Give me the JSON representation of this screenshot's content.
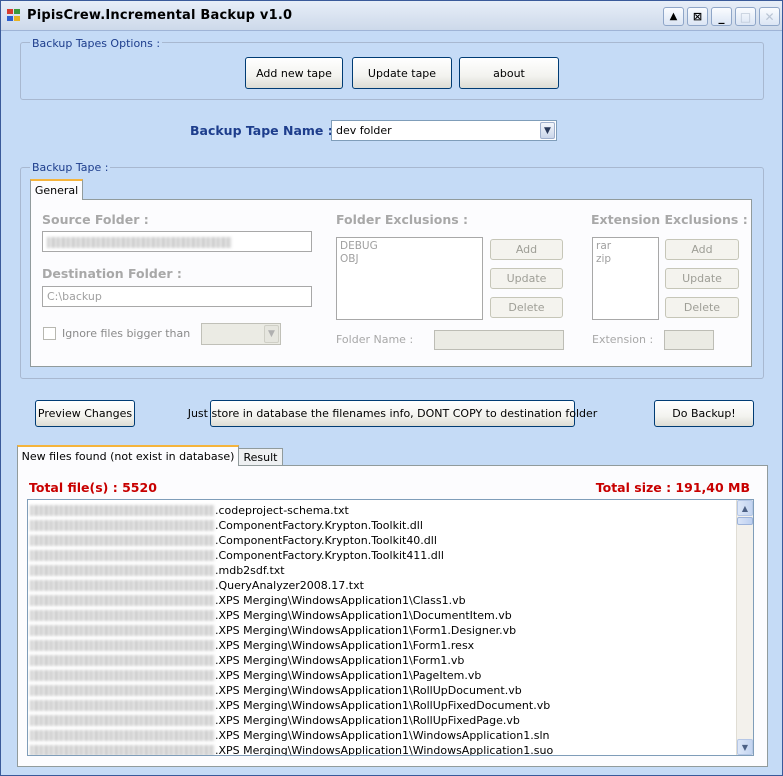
{
  "window": {
    "title": "PipisCrew.Incremental Backup v1.0",
    "controls": {
      "up": "▲",
      "pin": "⊠",
      "minimize": "_",
      "maximize": "□",
      "close": "✕"
    }
  },
  "tape_options": {
    "title": "Backup Tapes Options :",
    "buttons": {
      "add_new": "Add new tape",
      "update": "Update tape",
      "about": "about"
    }
  },
  "tape_name": {
    "label": "Backup Tape Name :",
    "selected": "dev folder"
  },
  "backup_tape": {
    "title": "Backup Tape :",
    "tab_general": "General",
    "source_label": "Source Folder :",
    "destination_label": "Destination Folder :",
    "destination_value": "C:\\backup",
    "ignore_label": "Ignore files bigger than",
    "folder_exclusions": {
      "title": "Folder Exclusions :",
      "items": [
        "DEBUG",
        "OBJ"
      ],
      "add": "Add",
      "update": "Update",
      "delete": "Delete",
      "name_label": "Folder Name :"
    },
    "extension_exclusions": {
      "title": "Extension Exclusions :",
      "items": [
        "rar",
        "zip"
      ],
      "add": "Add",
      "update": "Update",
      "delete": "Delete",
      "name_label": "Extension :"
    }
  },
  "actions": {
    "preview": "Preview Changes",
    "store_only": "Just store in database the filenames info, DONT COPY to destination folder",
    "do_backup": "Do Backup!"
  },
  "results": {
    "tab_new": "New files found (not exist in database)",
    "tab_result": "Result",
    "total_files": "Total file(s) : 5520",
    "total_size": "Total size : 191,40 MB",
    "files": [
      ".codeproject-schema.txt",
      ".ComponentFactory.Krypton.Toolkit.dll",
      ".ComponentFactory.Krypton.Toolkit40.dll",
      ".ComponentFactory.Krypton.Toolkit411.dll",
      ".mdb2sdf.txt",
      ".QueryAnalyzer2008.17.txt",
      ".XPS Merging\\WindowsApplication1\\Class1.vb",
      ".XPS Merging\\WindowsApplication1\\DocumentItem.vb",
      ".XPS Merging\\WindowsApplication1\\Form1.Designer.vb",
      ".XPS Merging\\WindowsApplication1\\Form1.resx",
      ".XPS Merging\\WindowsApplication1\\Form1.vb",
      ".XPS Merging\\WindowsApplication1\\PageItem.vb",
      ".XPS Merging\\WindowsApplication1\\RollUpDocument.vb",
      ".XPS Merging\\WindowsApplication1\\RollUpFixedDocument.vb",
      ".XPS Merging\\WindowsApplication1\\RollUpFixedPage.vb",
      ".XPS Merging\\WindowsApplication1\\WindowsApplication1.sln",
      ".XPS Merging\\WindowsApplication1\\WindowsApplication1.suo"
    ]
  },
  "icons": {
    "app": "app-icon",
    "scroll_up": "scroll-up-arrow-icon",
    "scroll_down": "scroll-down-arrow-icon",
    "dropdown": "chevron-down-icon"
  },
  "colors": {
    "window_bg": "#c5dbf6",
    "total_text": "#c80000",
    "label_blue": "#1d3d8c",
    "active_tab": "#f5b43c"
  }
}
